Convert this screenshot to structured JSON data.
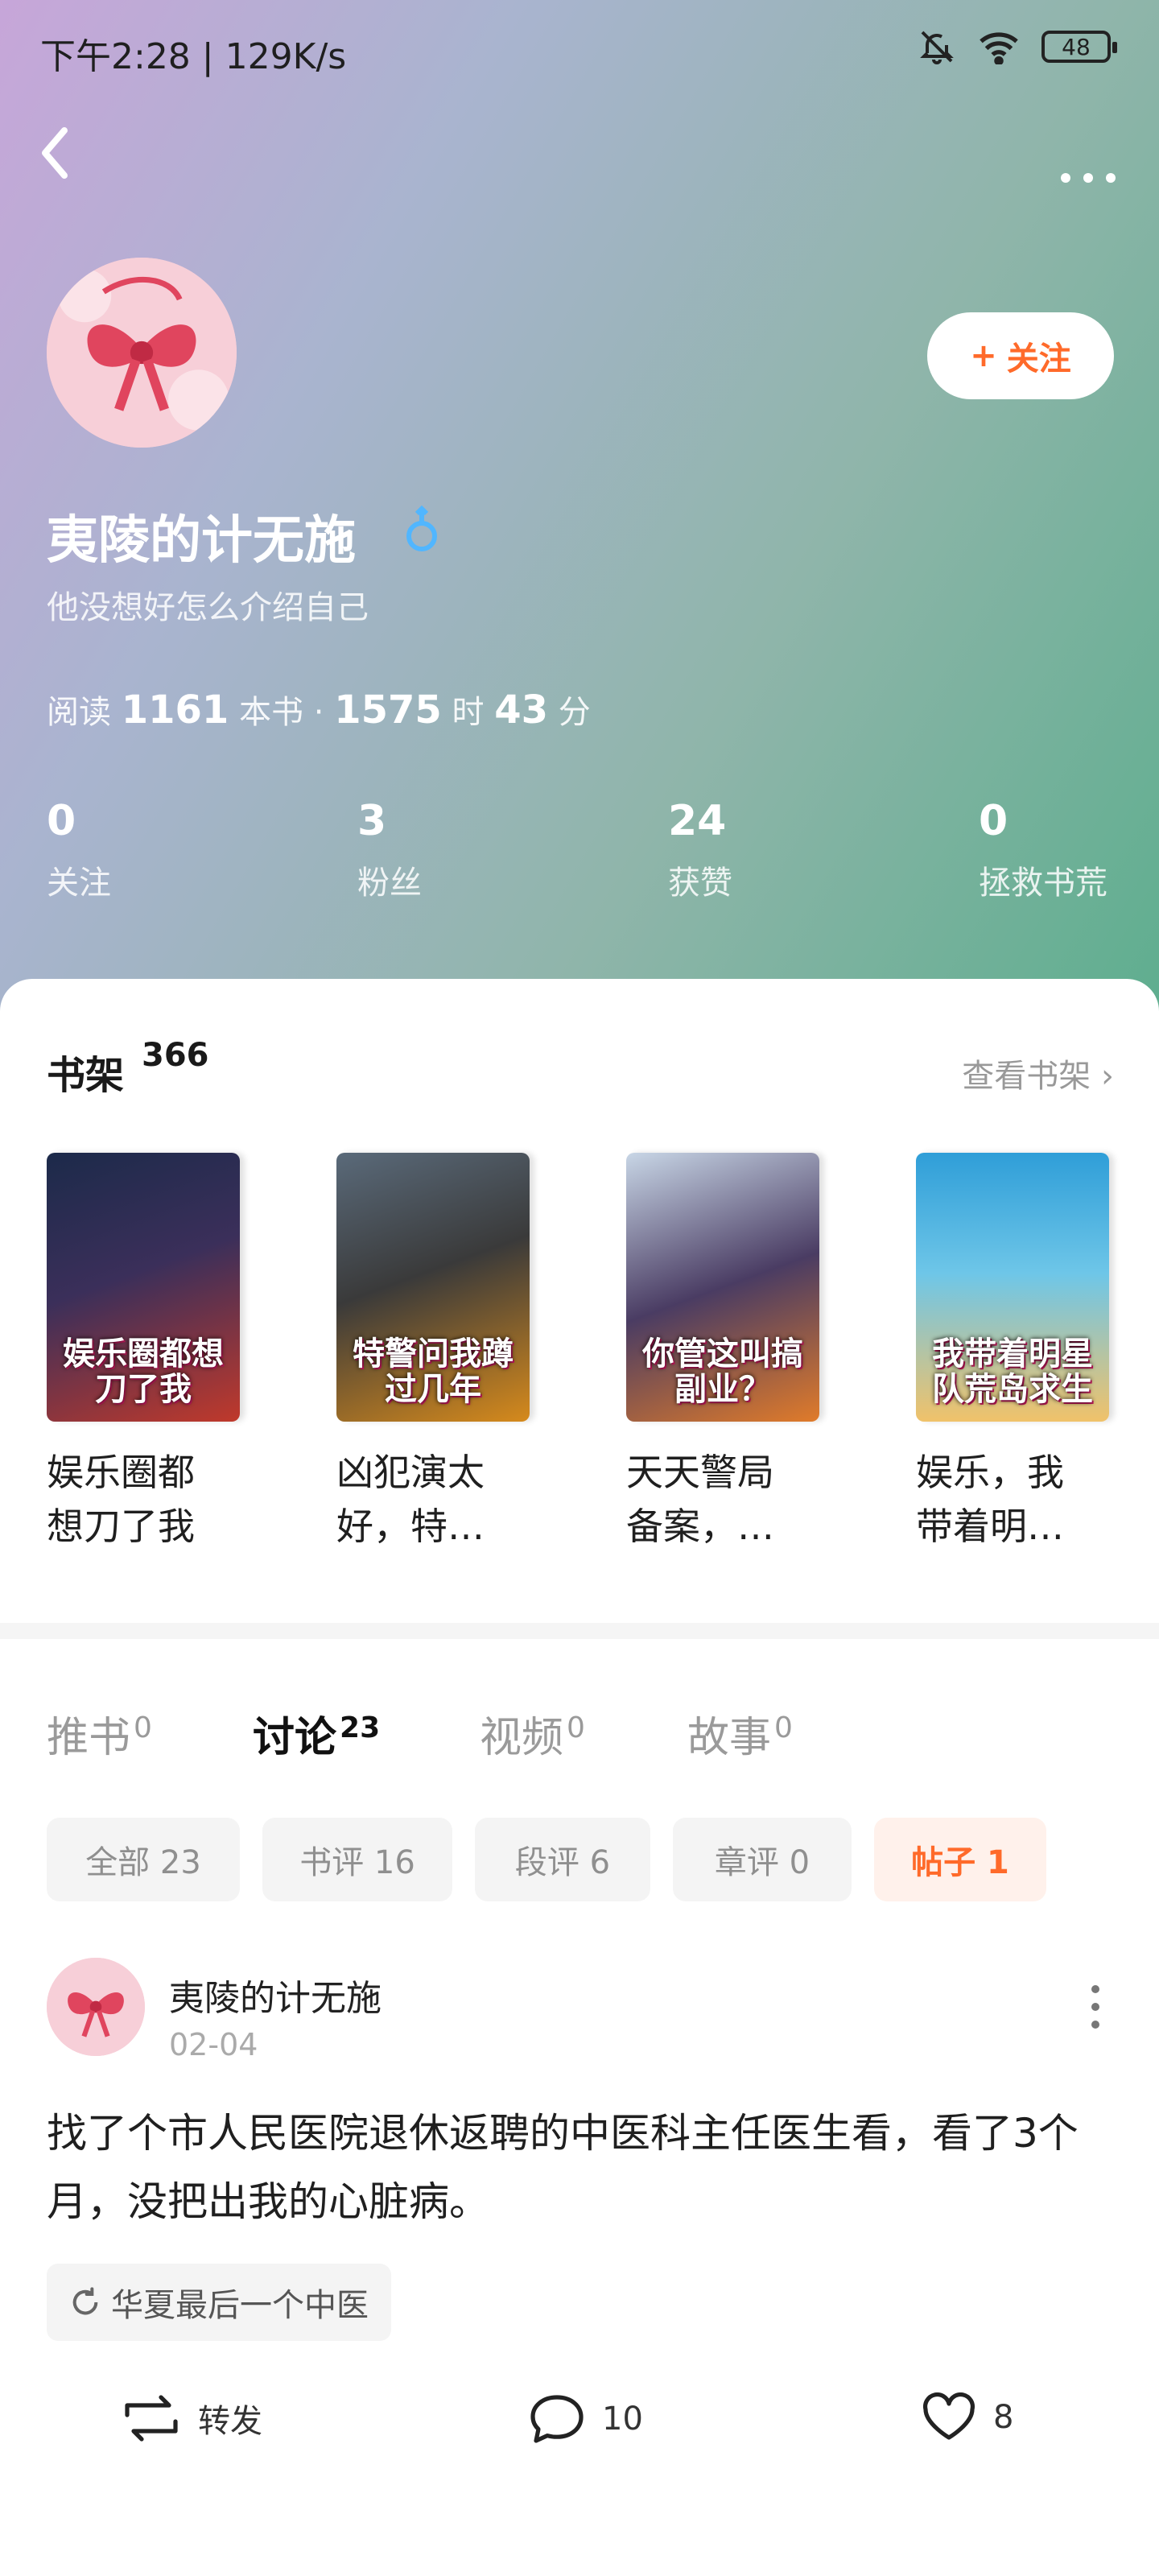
{
  "status_bar": {
    "time": "下午2:28 | 129K/s",
    "battery": "48"
  },
  "profile": {
    "name": "夷陵的计无施",
    "bio": "他没想好怎么介绍自己",
    "follow_label": "关注",
    "reading": {
      "prefix": "阅读",
      "books": "1161",
      "books_unit": "本书 ·",
      "hours": "1575",
      "hours_unit": "时",
      "minutes": "43",
      "minutes_unit": "分"
    },
    "counters": [
      {
        "value": "0",
        "label": "关注"
      },
      {
        "value": "3",
        "label": "粉丝"
      },
      {
        "value": "24",
        "label": "获赞"
      },
      {
        "value": "0",
        "label": "拯救书荒"
      }
    ]
  },
  "bookshelf": {
    "title": "书架",
    "count": "366",
    "link": "查看书架",
    "books": [
      {
        "cover_text": "娱乐圈都想刀了我",
        "name_line1": "娱乐圈都",
        "name_line2": "想刀了我",
        "colors": [
          "#1c2a4a",
          "#c0392b"
        ]
      },
      {
        "cover_text": "特警问我蹲过几年",
        "name_line1": "凶犯演太",
        "name_line2": "好，特…",
        "colors": [
          "#3a3a3a",
          "#d68a1c"
        ]
      },
      {
        "cover_text": "你管这叫搞副业？",
        "name_line1": "天天警局",
        "name_line2": "备案，…",
        "colors": [
          "#4a3c63",
          "#e07b2a"
        ]
      },
      {
        "cover_text": "我带着明星队荒岛求生",
        "name_line1": "娱乐，我",
        "name_line2": "带着明…",
        "colors": [
          "#2f9ed8",
          "#f0c26a"
        ]
      }
    ]
  },
  "tabs": [
    {
      "label": "推书",
      "count": "0"
    },
    {
      "label": "讨论",
      "count": "23"
    },
    {
      "label": "视频",
      "count": "0"
    },
    {
      "label": "故事",
      "count": "0"
    }
  ],
  "filters": [
    {
      "label": "全部 23"
    },
    {
      "label": "书评 16"
    },
    {
      "label": "段评 6"
    },
    {
      "label": "章评 0"
    },
    {
      "label": "帖子 1"
    }
  ],
  "post": {
    "author": "夷陵的计无施",
    "date": "02-04",
    "text": "找了个市人民医院退休返聘的中医科主任医生看，看了3个月，没把出我的心脏病。",
    "topic": "华夏最后一个中医",
    "repost_label": "转发",
    "comments": "10",
    "likes": "8"
  },
  "colors": {
    "accent": "#ff6a2a",
    "gender": "#51b6ff"
  }
}
